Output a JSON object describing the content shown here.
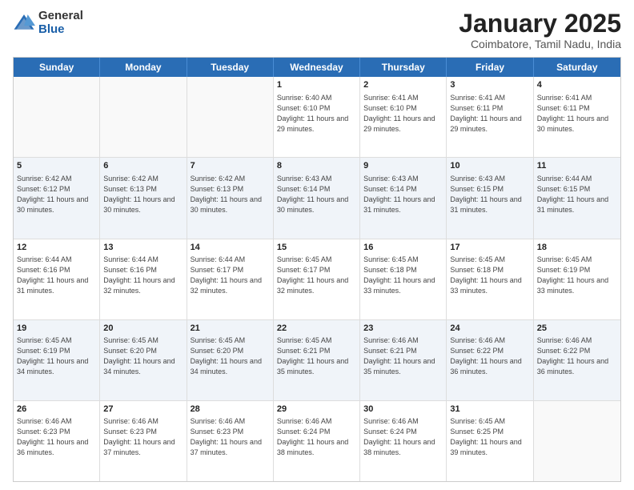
{
  "header": {
    "logo_general": "General",
    "logo_blue": "Blue",
    "title": "January 2025",
    "location": "Coimbatore, Tamil Nadu, India"
  },
  "weekdays": [
    "Sunday",
    "Monday",
    "Tuesday",
    "Wednesday",
    "Thursday",
    "Friday",
    "Saturday"
  ],
  "weeks": [
    [
      {
        "day": "",
        "empty": true
      },
      {
        "day": "",
        "empty": true
      },
      {
        "day": "",
        "empty": true
      },
      {
        "day": "1",
        "sunrise": "Sunrise: 6:40 AM",
        "sunset": "Sunset: 6:10 PM",
        "daylight": "Daylight: 11 hours and 29 minutes."
      },
      {
        "day": "2",
        "sunrise": "Sunrise: 6:41 AM",
        "sunset": "Sunset: 6:10 PM",
        "daylight": "Daylight: 11 hours and 29 minutes."
      },
      {
        "day": "3",
        "sunrise": "Sunrise: 6:41 AM",
        "sunset": "Sunset: 6:11 PM",
        "daylight": "Daylight: 11 hours and 29 minutes."
      },
      {
        "day": "4",
        "sunrise": "Sunrise: 6:41 AM",
        "sunset": "Sunset: 6:11 PM",
        "daylight": "Daylight: 11 hours and 30 minutes."
      }
    ],
    [
      {
        "day": "5",
        "sunrise": "Sunrise: 6:42 AM",
        "sunset": "Sunset: 6:12 PM",
        "daylight": "Daylight: 11 hours and 30 minutes."
      },
      {
        "day": "6",
        "sunrise": "Sunrise: 6:42 AM",
        "sunset": "Sunset: 6:13 PM",
        "daylight": "Daylight: 11 hours and 30 minutes."
      },
      {
        "day": "7",
        "sunrise": "Sunrise: 6:42 AM",
        "sunset": "Sunset: 6:13 PM",
        "daylight": "Daylight: 11 hours and 30 minutes."
      },
      {
        "day": "8",
        "sunrise": "Sunrise: 6:43 AM",
        "sunset": "Sunset: 6:14 PM",
        "daylight": "Daylight: 11 hours and 30 minutes."
      },
      {
        "day": "9",
        "sunrise": "Sunrise: 6:43 AM",
        "sunset": "Sunset: 6:14 PM",
        "daylight": "Daylight: 11 hours and 31 minutes."
      },
      {
        "day": "10",
        "sunrise": "Sunrise: 6:43 AM",
        "sunset": "Sunset: 6:15 PM",
        "daylight": "Daylight: 11 hours and 31 minutes."
      },
      {
        "day": "11",
        "sunrise": "Sunrise: 6:44 AM",
        "sunset": "Sunset: 6:15 PM",
        "daylight": "Daylight: 11 hours and 31 minutes."
      }
    ],
    [
      {
        "day": "12",
        "sunrise": "Sunrise: 6:44 AM",
        "sunset": "Sunset: 6:16 PM",
        "daylight": "Daylight: 11 hours and 31 minutes."
      },
      {
        "day": "13",
        "sunrise": "Sunrise: 6:44 AM",
        "sunset": "Sunset: 6:16 PM",
        "daylight": "Daylight: 11 hours and 32 minutes."
      },
      {
        "day": "14",
        "sunrise": "Sunrise: 6:44 AM",
        "sunset": "Sunset: 6:17 PM",
        "daylight": "Daylight: 11 hours and 32 minutes."
      },
      {
        "day": "15",
        "sunrise": "Sunrise: 6:45 AM",
        "sunset": "Sunset: 6:17 PM",
        "daylight": "Daylight: 11 hours and 32 minutes."
      },
      {
        "day": "16",
        "sunrise": "Sunrise: 6:45 AM",
        "sunset": "Sunset: 6:18 PM",
        "daylight": "Daylight: 11 hours and 33 minutes."
      },
      {
        "day": "17",
        "sunrise": "Sunrise: 6:45 AM",
        "sunset": "Sunset: 6:18 PM",
        "daylight": "Daylight: 11 hours and 33 minutes."
      },
      {
        "day": "18",
        "sunrise": "Sunrise: 6:45 AM",
        "sunset": "Sunset: 6:19 PM",
        "daylight": "Daylight: 11 hours and 33 minutes."
      }
    ],
    [
      {
        "day": "19",
        "sunrise": "Sunrise: 6:45 AM",
        "sunset": "Sunset: 6:19 PM",
        "daylight": "Daylight: 11 hours and 34 minutes."
      },
      {
        "day": "20",
        "sunrise": "Sunrise: 6:45 AM",
        "sunset": "Sunset: 6:20 PM",
        "daylight": "Daylight: 11 hours and 34 minutes."
      },
      {
        "day": "21",
        "sunrise": "Sunrise: 6:45 AM",
        "sunset": "Sunset: 6:20 PM",
        "daylight": "Daylight: 11 hours and 34 minutes."
      },
      {
        "day": "22",
        "sunrise": "Sunrise: 6:45 AM",
        "sunset": "Sunset: 6:21 PM",
        "daylight": "Daylight: 11 hours and 35 minutes."
      },
      {
        "day": "23",
        "sunrise": "Sunrise: 6:46 AM",
        "sunset": "Sunset: 6:21 PM",
        "daylight": "Daylight: 11 hours and 35 minutes."
      },
      {
        "day": "24",
        "sunrise": "Sunrise: 6:46 AM",
        "sunset": "Sunset: 6:22 PM",
        "daylight": "Daylight: 11 hours and 36 minutes."
      },
      {
        "day": "25",
        "sunrise": "Sunrise: 6:46 AM",
        "sunset": "Sunset: 6:22 PM",
        "daylight": "Daylight: 11 hours and 36 minutes."
      }
    ],
    [
      {
        "day": "26",
        "sunrise": "Sunrise: 6:46 AM",
        "sunset": "Sunset: 6:23 PM",
        "daylight": "Daylight: 11 hours and 36 minutes."
      },
      {
        "day": "27",
        "sunrise": "Sunrise: 6:46 AM",
        "sunset": "Sunset: 6:23 PM",
        "daylight": "Daylight: 11 hours and 37 minutes."
      },
      {
        "day": "28",
        "sunrise": "Sunrise: 6:46 AM",
        "sunset": "Sunset: 6:23 PM",
        "daylight": "Daylight: 11 hours and 37 minutes."
      },
      {
        "day": "29",
        "sunrise": "Sunrise: 6:46 AM",
        "sunset": "Sunset: 6:24 PM",
        "daylight": "Daylight: 11 hours and 38 minutes."
      },
      {
        "day": "30",
        "sunrise": "Sunrise: 6:46 AM",
        "sunset": "Sunset: 6:24 PM",
        "daylight": "Daylight: 11 hours and 38 minutes."
      },
      {
        "day": "31",
        "sunrise": "Sunrise: 6:45 AM",
        "sunset": "Sunset: 6:25 PM",
        "daylight": "Daylight: 11 hours and 39 minutes."
      },
      {
        "day": "",
        "empty": true
      }
    ]
  ]
}
